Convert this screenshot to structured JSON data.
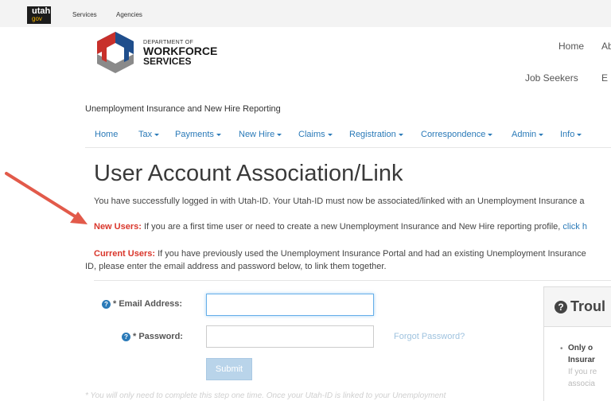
{
  "topbar": {
    "logo_top": "utah",
    "logo_bottom": "gov",
    "links": [
      "Services",
      "Agencies"
    ]
  },
  "brand": {
    "dept_line": "DEPARTMENT OF",
    "name_line1": "WORKFORCE",
    "name_line2": "SERVICES",
    "colors": {
      "red": "#c8302b",
      "blue": "#1f4e8c",
      "gray": "#8a8a8a"
    }
  },
  "main_nav": {
    "row1": [
      "Home",
      "Ab"
    ],
    "row2": [
      "Job Seekers",
      "E"
    ]
  },
  "app_title": "Unemployment Insurance and New Hire Reporting",
  "sub_nav": [
    {
      "label": "Home",
      "dropdown": false
    },
    {
      "label": "Tax",
      "dropdown": true
    },
    {
      "label": "Payments",
      "dropdown": true
    },
    {
      "label": "New Hire",
      "dropdown": true
    },
    {
      "label": "Claims",
      "dropdown": true
    },
    {
      "label": "Registration",
      "dropdown": true
    },
    {
      "label": "Correspondence",
      "dropdown": true
    },
    {
      "label": "Admin",
      "dropdown": true
    },
    {
      "label": "Info",
      "dropdown": true
    }
  ],
  "page_title": "User Account Association/Link",
  "intro": "You have successfully logged in with Utah-ID. Your Utah-ID must now be associated/linked with an Unemployment Insurance a",
  "new_users": {
    "label": "New Users:",
    "text": " If you are a first time user or need to create a new Unemployment Insurance and New Hire reporting profile, ",
    "link": "click h"
  },
  "current_users": {
    "label": "Current Users:",
    "text": " If you have previously used the Unemployment Insurance Portal and had an existing Unemployment Insurance",
    "line2": "ID, please enter the email address and password below, to link them together."
  },
  "form": {
    "email_label": "Email Address:",
    "password_label": "Password:",
    "required_mark": "*",
    "help_glyph": "?",
    "email_value": "",
    "password_value": "",
    "forgot_link": "Forgot Password?",
    "submit_label": "Submit"
  },
  "footnote": "* You will only need to complete this step one time. Once your Utah-ID is linked to your Unemployment",
  "panel": {
    "title": "Troul",
    "icon_glyph": "?",
    "lines": [
      "Only o",
      "Insurar",
      "If you re",
      "associa"
    ]
  }
}
